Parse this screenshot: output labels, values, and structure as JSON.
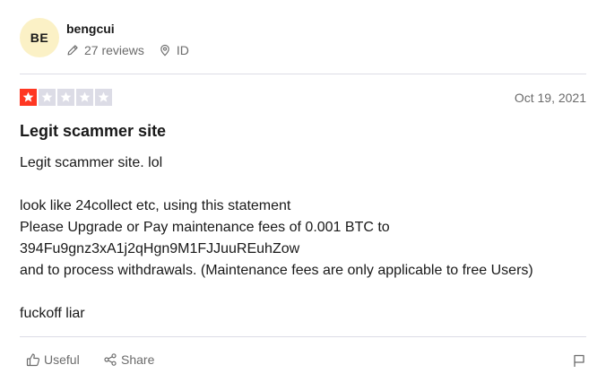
{
  "reviewer": {
    "initials": "BE",
    "name": "bengcui",
    "reviews_count": "27 reviews",
    "country": "ID",
    "avatar_color": "#fbf1c6"
  },
  "review": {
    "rating": 1,
    "max_rating": 5,
    "date": "Oct 19, 2021",
    "title": "Legit scammer site",
    "body_lines": [
      "Legit scammer site. lol",
      "",
      "look like 24collect etc, using this statement",
      "Please Upgrade or Pay maintenance fees of 0.001 BTC to",
      "394Fu9gnz3xA1j2qHgn9M1FJJuuREuhZow",
      "and to process withdrawals. (Maintenance fees are only applicable to free Users)",
      "",
      "fuckoff liar"
    ]
  },
  "actions": {
    "useful_label": "Useful",
    "share_label": "Share"
  },
  "icons": {
    "reviews": "pencil-icon",
    "location": "location-pin-icon",
    "useful": "thumbs-up-icon",
    "share": "share-icon",
    "report": "flag-icon",
    "star": "star-icon"
  },
  "colors": {
    "star_filled": "#ff3722",
    "star_empty": "#dcdce6",
    "muted_text": "#6b6b6b",
    "divider": "#dcdce6"
  }
}
